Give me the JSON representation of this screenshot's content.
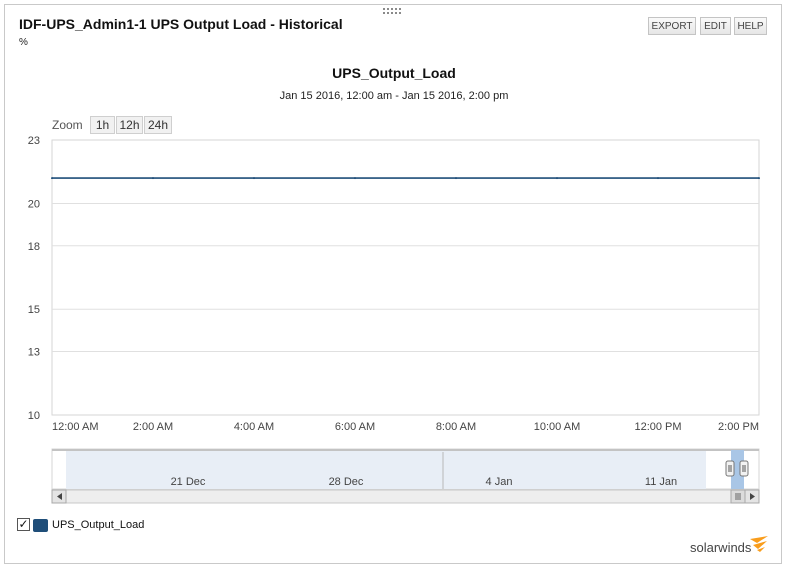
{
  "header": {
    "title": "IDF-UPS_Admin1-1 UPS Output Load - Historical",
    "unit": "%",
    "export_label": "EXPORT",
    "edit_label": "EDIT",
    "help_label": "HELP"
  },
  "zoom": {
    "label": "Zoom",
    "options": [
      "1h",
      "12h",
      "24h"
    ]
  },
  "chart_data": {
    "type": "line",
    "title": "UPS_Output_Load",
    "subtitle": "Jan 15 2016, 12:00 am - Jan 15 2016, 2:00 pm",
    "x_tick_labels": [
      "12:00 AM",
      "2:00 AM",
      "4:00 AM",
      "6:00 AM",
      "8:00 AM",
      "10:00 AM",
      "12:00 PM",
      "2:00 PM"
    ],
    "y_tick_labels": [
      "23",
      "20",
      "18",
      "15",
      "13",
      "10"
    ],
    "ylim": [
      10,
      23
    ],
    "xlim_hours": [
      0,
      14
    ],
    "grid": true,
    "series": [
      {
        "name": "UPS_Output_Load",
        "color": "#1f4e79",
        "x_hours": [
          0,
          2,
          4,
          6,
          8,
          10,
          12,
          14
        ],
        "values": [
          21.2,
          21.2,
          21.2,
          21.2,
          21.2,
          21.2,
          21.2,
          21.2
        ]
      }
    ],
    "navigator_labels": [
      "21 Dec",
      "28 Dec",
      "4 Jan",
      "11 Jan"
    ]
  },
  "legend": {
    "checked": true,
    "label": "UPS_Output_Load"
  },
  "brand": {
    "name": "solarwinds",
    "accent": "#f99d1c"
  }
}
